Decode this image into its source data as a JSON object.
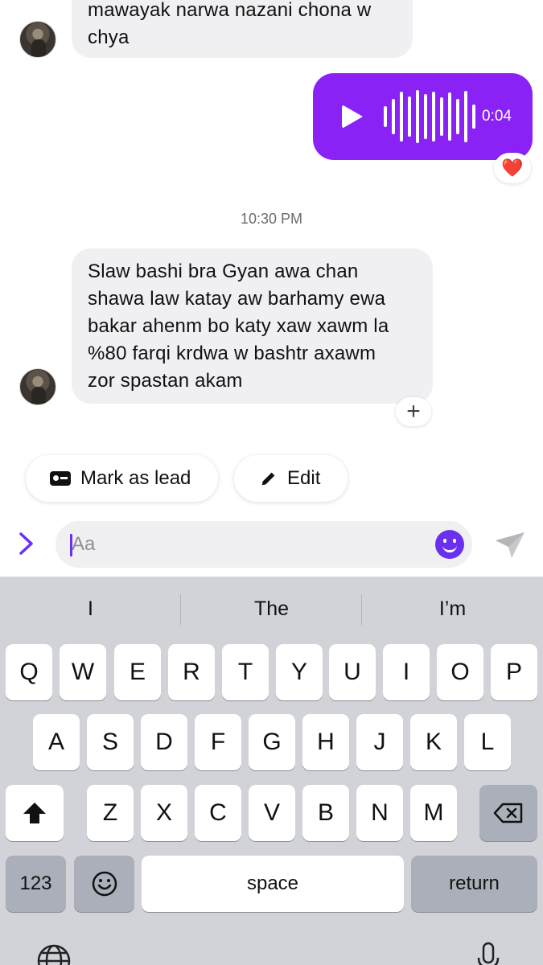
{
  "thread": {
    "incoming_1_text": "mawayak narwa nazani chona w\nchya",
    "voice_message": {
      "duration": "0:04",
      "reaction": "❤️"
    },
    "timestamp": "10:30 PM",
    "incoming_2_text": "Slaw bashi bra Gyan awa chan\nshawa law katay aw barhamy ewa\nbakar ahenm bo katy xaw xawm la\n%80 farqi krdwa w bashtr axawm\nzor spastan akam",
    "add_reaction_label": "+"
  },
  "actions": {
    "mark_as_lead": "Mark as lead",
    "edit": "Edit"
  },
  "composer": {
    "placeholder": "Aa",
    "expand_icon": "chevron-right-icon",
    "emoji_icon": "smiley-icon",
    "send_icon": "send-icon"
  },
  "keyboard": {
    "suggestions": [
      "I",
      "The",
      "I’m"
    ],
    "row1": [
      "Q",
      "W",
      "E",
      "R",
      "T",
      "Y",
      "U",
      "I",
      "O",
      "P"
    ],
    "row2": [
      "A",
      "S",
      "D",
      "F",
      "G",
      "H",
      "J",
      "K",
      "L"
    ],
    "row3": [
      "Z",
      "X",
      "C",
      "V",
      "B",
      "N",
      "M"
    ],
    "numbers_label": "123",
    "space_label": "space",
    "return_label": "return"
  },
  "colors": {
    "accent": "#8a22f5",
    "composer_accent": "#6b2ff0",
    "bubble_in": "#f0f0f3",
    "keyboard_bg": "#d1d3d9"
  }
}
